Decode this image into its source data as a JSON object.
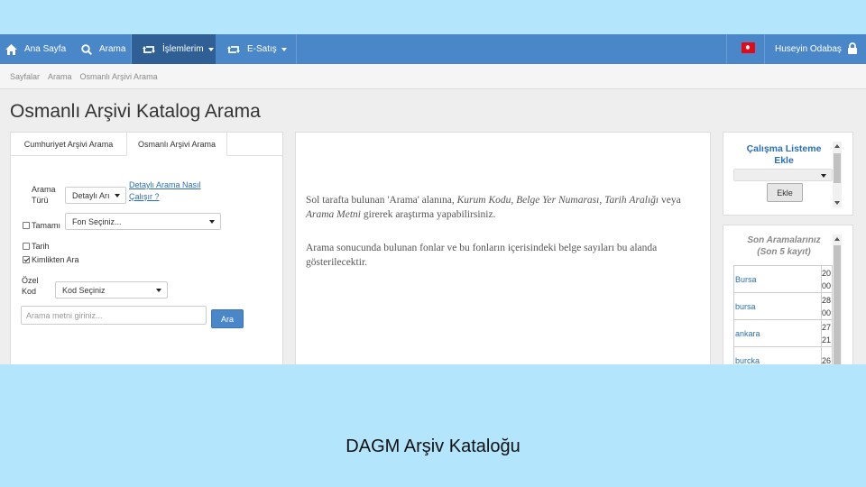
{
  "navbar": {
    "items": [
      {
        "label": "Ana Sayfa",
        "icon": "home-icon"
      },
      {
        "label": "Arama",
        "icon": "search-icon"
      },
      {
        "label": "İşlemlerim",
        "icon": "retweet-icon"
      },
      {
        "label": "E-Satış",
        "icon": "retweet-icon"
      }
    ],
    "user_name": "Huseyin Odabaş",
    "lang_flag": "turkey-flag-icon",
    "lock_icon": "lock-icon",
    "bg_color": "#4a87c9",
    "active_color": "#2f5f94"
  },
  "breadcrumb": [
    "Sayfalar",
    "Arama",
    "Osmanlı Arşivi Arama"
  ],
  "page_title": "Osmanlı Arşivi Katalog Arama",
  "search_panel": {
    "tabs": [
      "Cumhuriyet Arşivi Arama",
      "Osmanlı Arşivi Arama"
    ],
    "arama_turu_label": [
      "Arama",
      "Türü"
    ],
    "arama_turu_value": "Detaylı Arı",
    "help_link": [
      "Detaylı Arama Nasıl",
      "Çalışır ?"
    ],
    "tamami_label": "Tamamı",
    "fon_select": "Fon Seçiniz...",
    "tarih_label": "Tarih",
    "kimlikten_label": "Kimlikten Ara",
    "ozel_kod_label": [
      "Özel",
      "Kod"
    ],
    "kod_select": "Kod Seçiniz",
    "search_placeholder": "Arama metni giriniz...",
    "search_button": "Ara"
  },
  "info_panel": {
    "para1_a": "Sol tarafta bulunan 'Arama' alanına, ",
    "para1_b": "Kurum Kodu, Belge Yer Numarası, Tarih",
    "para1_c": "Aralığı",
    "para1_d": " veya ",
    "para1_e": "Arama Metni",
    "para1_f": " girerek araştırma yapabilirsiniz.",
    "para2": "Arama sonucunda bulunan fonlar ve bu fonların içerisindeki belge sayıları bu alanda gösterilecektir."
  },
  "work_list": {
    "title": [
      "Çalışma Listeme",
      "Ekle"
    ],
    "button": "Ekle"
  },
  "recent_searches": {
    "title": [
      "Son Aramalarınız",
      "(Son 5 kayıt)"
    ],
    "rows": [
      {
        "city": "Bursa",
        "d1": "20",
        "d2": "00"
      },
      {
        "city": "bursa",
        "d1": "28",
        "d2": "00"
      },
      {
        "city": "ankara",
        "d1": "27",
        "d2": "21"
      },
      {
        "city": "burcka",
        "d1": "26",
        "d2": ""
      }
    ]
  },
  "caption": "DAGM Arşiv Kataloğu"
}
